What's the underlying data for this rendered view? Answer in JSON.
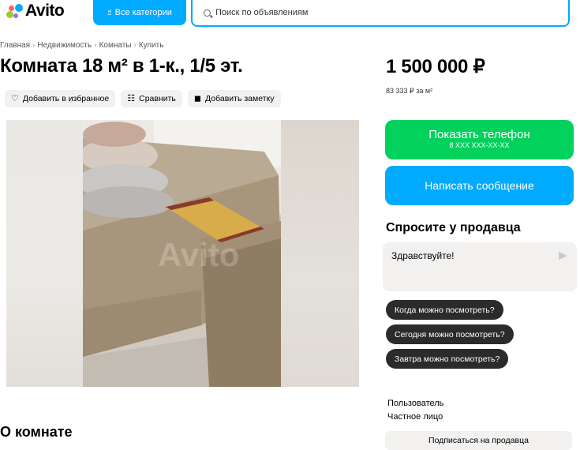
{
  "header": {
    "logo_text": "Avito",
    "categories_label": "Все категории",
    "search_placeholder": "Поиск по объявлениям"
  },
  "breadcrumb": [
    "Главная",
    "Недвижимость",
    "Комнаты",
    "Купить"
  ],
  "listing": {
    "title": "Комната 18 м² в 1-к., 1/5 эт.",
    "price": "1 500 000 ₽",
    "price_per_meter": "83 333 ₽ за м²"
  },
  "actions": {
    "favorite": "Добавить в избранное",
    "compare": "Сравнить",
    "note": "Добавить заметку"
  },
  "gallery": {
    "watermark": "Avito"
  },
  "contact": {
    "show_phone": "Показать телефон",
    "phone_masked": "8 XXX XXX-XX-XX",
    "write_message": "Написать сообщение"
  },
  "ask": {
    "title": "Спросите у продавца",
    "message_value": "Здравствуйте!",
    "quick_questions": [
      "Когда можно посмотреть?",
      "Сегодня можно посмотреть?",
      "Завтра можно посмотреть?"
    ]
  },
  "seller": {
    "name": "Пользователь",
    "type": "Частное лицо",
    "subscribe": "Подписаться на продавца"
  },
  "section": {
    "about_title": "О комнате"
  },
  "colors": {
    "accent_blue": "#00aaff",
    "phone_green": "#02d15c",
    "chip_dark": "#2b2b2b",
    "light_bg": "#f2f1f0"
  }
}
